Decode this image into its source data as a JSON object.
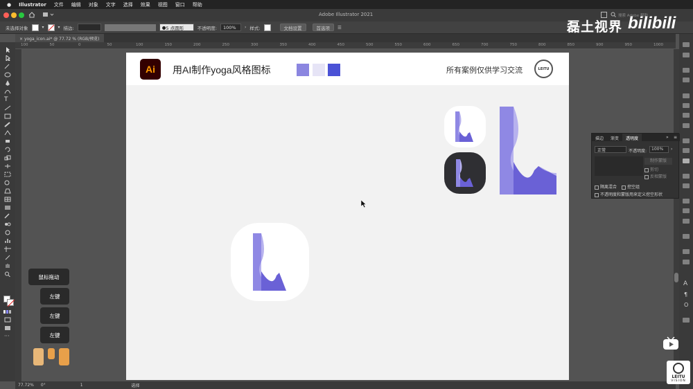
{
  "menubar": {
    "app": "Illustrator",
    "items": [
      "文件",
      "编辑",
      "对象",
      "文字",
      "选择",
      "效果",
      "视图",
      "窗口",
      "帮助"
    ]
  },
  "window": {
    "title": "Adobe Illustrator 2021",
    "search_placeholder": "搜索 Adobe 帮助"
  },
  "controlbar": {
    "no_selection": "未选择对象",
    "stroke_label": "描边:",
    "brush_label": "5 点圆形",
    "opacity_label": "不透明度:",
    "opacity_value": "100%",
    "style_label": "样式:",
    "doc_setup": "文档设置",
    "preferences": "首选项"
  },
  "document_tab": {
    "label": "yoga_icon.ai* @ 77.72 % (RGB/预览)"
  },
  "ruler_ticks": [
    "100",
    "50",
    "0",
    "50",
    "100",
    "150",
    "200",
    "250",
    "300",
    "350",
    "400",
    "450",
    "500",
    "550",
    "600",
    "650",
    "700",
    "750",
    "800",
    "850",
    "900",
    "950",
    "1000"
  ],
  "artboard": {
    "logo_text": "Ai",
    "title": "用AI制作yoga风格图标",
    "caption": "所有案例仅供学习交流",
    "seal_text": "LEITU",
    "swatches": [
      "#8b86e0",
      "#e6e4f6",
      "#4b52d6"
    ],
    "colors": {
      "purple_light": "#b7b2ee",
      "purple_mid": "#8f88e4",
      "purple_dark": "#6a61d6",
      "dark_bg": "#2f2f33"
    }
  },
  "transparency_panel": {
    "tabs": [
      "描边",
      "渐变",
      "透明度"
    ],
    "blend_mode": "正常",
    "opacity_label": "不透明度:",
    "opacity_value": "100%",
    "make_mask": "制作蒙版",
    "clip": "剪切",
    "invert_mask": "反相蒙版",
    "isolate_blending": "隔离混合",
    "knockout_group": "挖空组",
    "opacity_mask_shape": "不透明度和蒙版用来定义挖空形状"
  },
  "mouse_hints": {
    "drag": "鼠标拖动",
    "left_click": "左键"
  },
  "statusbar": {
    "zoom": "77.72%",
    "rotation": "0°",
    "artboard_num": "1",
    "tool": "选择"
  },
  "watermark": {
    "channel": "磊土视界",
    "site": "bilibili",
    "brand": "LEITU",
    "brand_sub": "VISION"
  }
}
